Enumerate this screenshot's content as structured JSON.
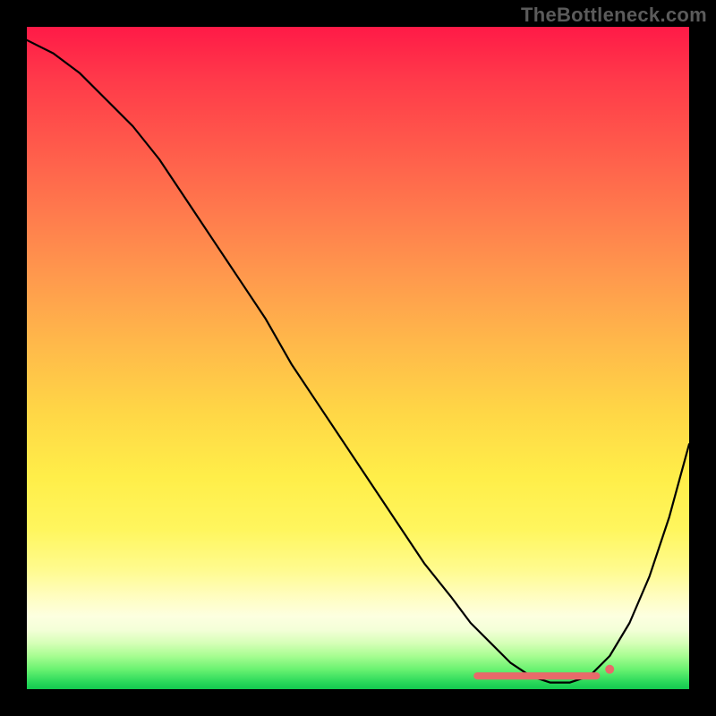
{
  "watermark": "TheBottleneck.com",
  "chart_data": {
    "type": "line",
    "title": "",
    "xlabel": "",
    "ylabel": "",
    "xlim": [
      0,
      100
    ],
    "ylim": [
      0,
      100
    ],
    "grid": false,
    "legend": false,
    "series": [
      {
        "name": "curve",
        "x": [
          0,
          4,
          8,
          12,
          16,
          20,
          24,
          28,
          32,
          36,
          40,
          44,
          48,
          52,
          56,
          60,
          64,
          67,
          70,
          73,
          76,
          79,
          82,
          85,
          88,
          91,
          94,
          97,
          100
        ],
        "y": [
          98,
          96,
          93,
          89,
          85,
          80,
          74,
          68,
          62,
          56,
          49,
          43,
          37,
          31,
          25,
          19,
          14,
          10,
          7,
          4,
          2,
          1,
          1,
          2,
          5,
          10,
          17,
          26,
          37
        ]
      }
    ],
    "optimal_band": {
      "x_start": 68,
      "x_end": 86,
      "y": 2
    },
    "optimal_marker_dot": {
      "x": 88,
      "y": 3
    },
    "colors": {
      "gradient_top": "#ff1a47",
      "gradient_mid": "#ffd646",
      "gradient_bottom": "#13c94f",
      "curve": "#000000",
      "marker": "#e86a6a"
    }
  }
}
